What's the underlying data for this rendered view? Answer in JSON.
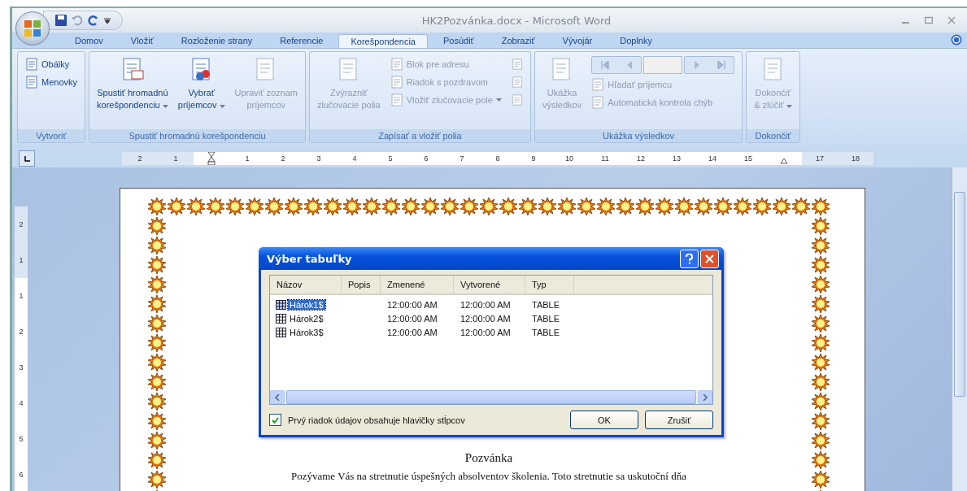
{
  "window": {
    "title": "HK2Pozvánka.docx - Microsoft Word"
  },
  "tabs": [
    {
      "label": "Domov",
      "selected": false
    },
    {
      "label": "Vložiť",
      "selected": false
    },
    {
      "label": "Rozloženie strany",
      "selected": false
    },
    {
      "label": "Referencie",
      "selected": false
    },
    {
      "label": "Korešpondencia",
      "selected": true
    },
    {
      "label": "Posúdiť",
      "selected": false
    },
    {
      "label": "Zobraziť",
      "selected": false
    },
    {
      "label": "Vývojár",
      "selected": false
    },
    {
      "label": "Doplnky",
      "selected": false
    }
  ],
  "ribbon_groups": [
    {
      "label": "Vytvoriť",
      "items": [
        {
          "kind": "stack",
          "items": [
            {
              "label": "Obálky",
              "disabled": false,
              "dropdown": false
            },
            {
              "label": "Menovky",
              "disabled": false,
              "dropdown": false
            }
          ]
        }
      ]
    },
    {
      "label": "Spustiť hromadnú korešpondenciu",
      "items": [
        {
          "kind": "large",
          "lines": [
            "Spustiť hromadnú",
            "korešpondenciu"
          ],
          "disabled": false,
          "dropdown": true
        },
        {
          "kind": "large",
          "lines": [
            "Vybrať",
            "príjemcov"
          ],
          "disabled": false,
          "dropdown": true
        },
        {
          "kind": "large",
          "lines": [
            "Upraviť zoznam",
            "príjemcov"
          ],
          "disabled": true,
          "dropdown": false
        }
      ]
    },
    {
      "label": "Zapísať a vložiť polia",
      "items": [
        {
          "kind": "large",
          "lines": [
            "Zvýrazniť",
            "zlučovacie polia"
          ],
          "disabled": true,
          "dropdown": false
        },
        {
          "kind": "stack",
          "items": [
            {
              "label": "Blok pre adresu",
              "disabled": true,
              "dropdown": false
            },
            {
              "label": "Riadok s pozdravom",
              "disabled": true,
              "dropdown": false
            },
            {
              "label": "Vložiť zlučovacie pole",
              "disabled": true,
              "dropdown": true
            }
          ]
        },
        {
          "kind": "icons"
        }
      ]
    },
    {
      "label": "Ukážka výsledkov",
      "items": [
        {
          "kind": "large",
          "lines": [
            "Ukážka",
            "výsledkov"
          ],
          "disabled": true,
          "dropdown": false
        },
        {
          "kind": "nav",
          "items": [
            {
              "label": "Hľadať príjemcu",
              "disabled": true,
              "dropdown": false
            },
            {
              "label": "Automatická kontrola chýb",
              "disabled": true,
              "dropdown": false
            }
          ]
        }
      ]
    },
    {
      "label": "Dokončiť",
      "items": [
        {
          "kind": "large",
          "lines": [
            "Dokončiť",
            "& zlúčiť"
          ],
          "disabled": true,
          "dropdown": true
        }
      ]
    }
  ],
  "ruler": {
    "left_labels": [
      "2",
      "1"
    ],
    "labels": [
      "1",
      "2",
      "3",
      "4",
      "5",
      "6",
      "7",
      "8",
      "9",
      "10",
      "11",
      "12",
      "13",
      "14",
      "15"
    ],
    "right_labels": [
      "17",
      "18"
    ]
  },
  "vertical_ruler": {
    "top_labels": [
      "2",
      "1"
    ],
    "labels": [
      "1",
      "2",
      "3",
      "4",
      "5",
      "6"
    ]
  },
  "document": {
    "heading": "Pozvánka",
    "paragraph": "Pozývame Vás na stretnutie úspešných absolventov školenia. Toto stretnutie sa uskutoční dňa"
  },
  "dialog": {
    "title": "Výber tabuľky",
    "columns": [
      "Názov",
      "Popis",
      "Zmenené",
      "Vytvorené",
      "Typ"
    ],
    "rows": [
      {
        "cells": [
          "Hárok1$",
          "",
          "12:00:00 AM",
          "12:00:00 AM",
          "TABLE"
        ],
        "selected": true
      },
      {
        "cells": [
          "Hárok2$",
          "",
          "12:00:00 AM",
          "12:00:00 AM",
          "TABLE"
        ],
        "selected": false
      },
      {
        "cells": [
          "Hárok3$",
          "",
          "12:00:00 AM",
          "12:00:00 AM",
          "TABLE"
        ],
        "selected": false
      }
    ],
    "checkbox": {
      "label": "Prvý riadok údajov obsahuje hlavičky stĺpcov",
      "checked": true
    },
    "buttons": [
      "OK",
      "Zrušiť"
    ]
  }
}
